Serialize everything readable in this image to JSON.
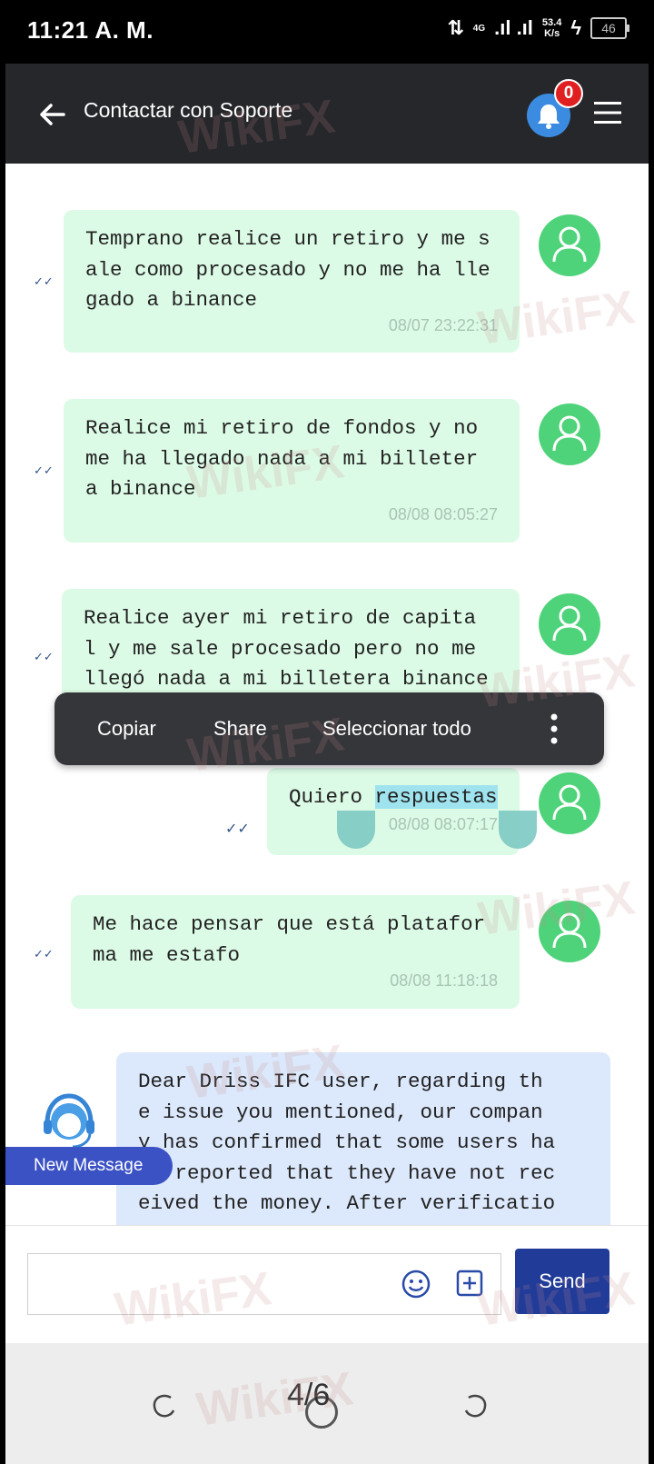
{
  "status_bar": {
    "time": "11:21 A. M.",
    "network": "4G",
    "speed_value": "53.4",
    "speed_unit": "K/s",
    "battery": "46"
  },
  "header": {
    "title": "Contactar con Soporte",
    "notification_count": "0"
  },
  "messages": [
    {
      "text": "Temprano realice un retiro y me s\nale como procesado y no me ha lle\ngado a binance",
      "time": "08/07 23:22:31"
    },
    {
      "text": "Realice mi retiro de fondos y no\nme ha llegado nada a mi billeter\na binance",
      "time": "08/08 08:05:27"
    },
    {
      "text": "Realice ayer mi retiro de capita\nl y me sale procesado pero no me\nllegó nada a mi billetera binance",
      "time": ""
    },
    {
      "text_before": "Quiero ",
      "text_selected": "respuestas",
      "time": "08/08 08:07:17"
    },
    {
      "text": "Me hace pensar que está platafor\nma me estafo",
      "time": "08/08 11:18:18"
    }
  ],
  "agent_message": {
    "text": "Dear Driss IFC user, regarding th\ne issue you mentioned, our compan\ny has confirmed that some users ha\nve reported that they have not rec\neived the money. After verificatio"
  },
  "context_menu": {
    "copy": "Copiar",
    "share": "Share",
    "select_all": "Seleccionar todo"
  },
  "new_message_label": "New Message",
  "input": {
    "placeholder": "",
    "send_label": "Send"
  },
  "gallery": {
    "page": "4/6"
  },
  "watermark": "WikiFX"
}
